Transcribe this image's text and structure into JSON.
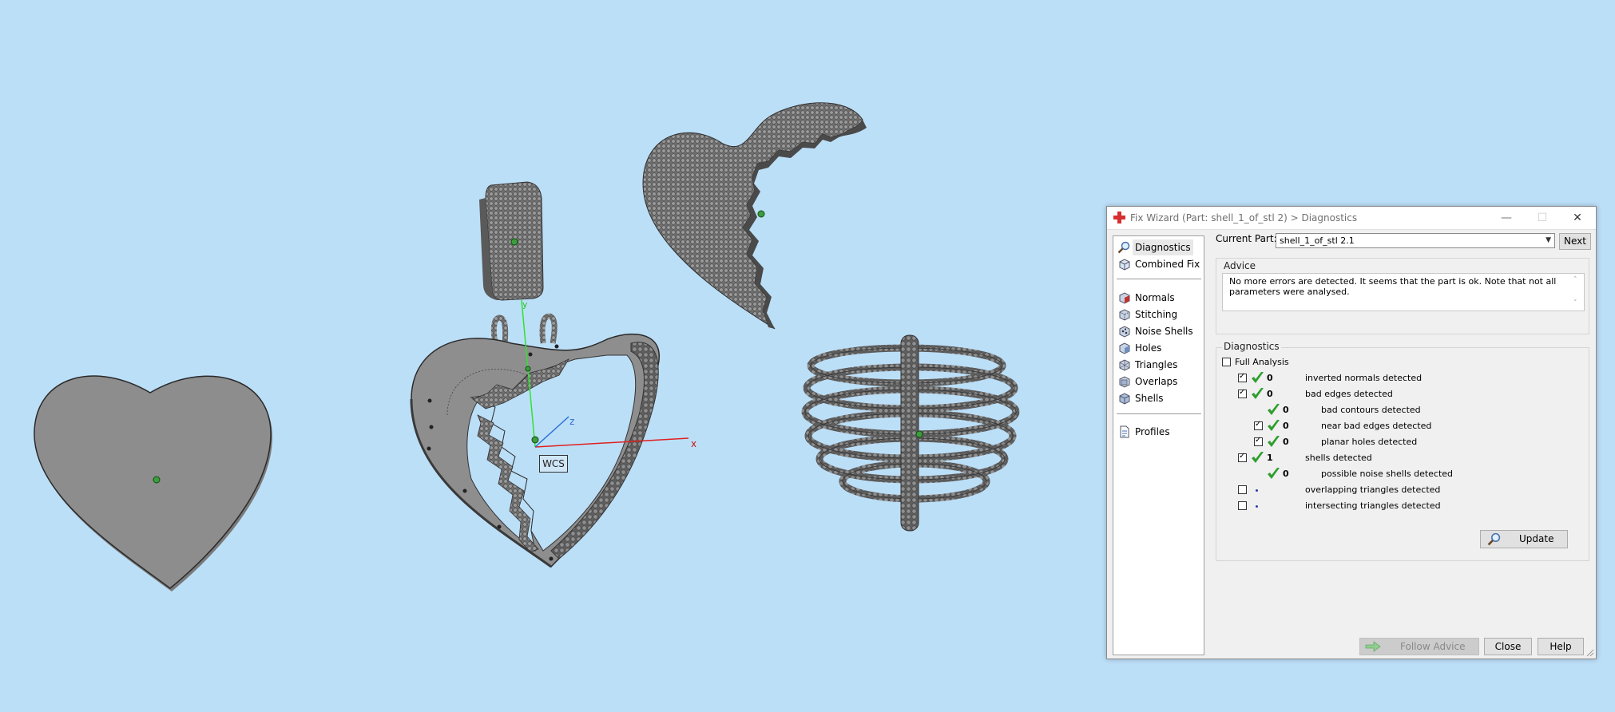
{
  "viewport": {
    "wcs_label": "WCS",
    "axis_x": "x",
    "axis_y": "y",
    "axis_z": "z"
  },
  "dialog": {
    "title": "Fix Wizard (Part: shell_1_of_stl 2) > Diagnostics",
    "window_controls": {
      "minimize": "—",
      "maximize": "☐",
      "close": "✕"
    },
    "nav": {
      "top_items": [
        {
          "label": "Diagnostics",
          "icon": "magnifier-icon",
          "selected": true
        },
        {
          "label": "Combined Fix",
          "icon": "cube-icon"
        }
      ],
      "fix_items": [
        {
          "label": "Normals",
          "icon": "normals-cube-icon"
        },
        {
          "label": "Stitching",
          "icon": "stitching-cube-icon"
        },
        {
          "label": "Noise Shells",
          "icon": "noise-shells-icon"
        },
        {
          "label": "Holes",
          "icon": "holes-cube-icon"
        },
        {
          "label": "Triangles",
          "icon": "triangles-cube-icon"
        },
        {
          "label": "Overlaps",
          "icon": "overlaps-cube-icon"
        },
        {
          "label": "Shells",
          "icon": "shells-cube-icon"
        }
      ],
      "bottom_items": [
        {
          "label": "Profiles",
          "icon": "profiles-icon"
        }
      ]
    },
    "current_part_label": "Current Part:",
    "current_part_value": "shell_1_of_stl 2.1",
    "next_button": "Next",
    "advice": {
      "title": "Advice",
      "text": "No more errors are detected. It seems that the part is ok. Note that not all parameters were analysed."
    },
    "diagnostics": {
      "title": "Diagnostics",
      "full_analysis_label": "Full Analysis",
      "full_analysis_checked": false,
      "rows": [
        {
          "label": "inverted normals detected",
          "value": "0",
          "checked": true,
          "ok": true,
          "has_checkbox": true,
          "indent": 0
        },
        {
          "label": "bad edges detected",
          "value": "0",
          "checked": true,
          "ok": true,
          "has_checkbox": true,
          "indent": 0
        },
        {
          "label": "bad contours detected",
          "value": "0",
          "checked": false,
          "ok": true,
          "has_checkbox": false,
          "indent": 1
        },
        {
          "label": "near bad edges detected",
          "value": "0",
          "checked": true,
          "ok": true,
          "has_checkbox": true,
          "indent": 1
        },
        {
          "label": "planar holes detected",
          "value": "0",
          "checked": true,
          "ok": true,
          "has_checkbox": true,
          "indent": 1
        },
        {
          "label": "shells detected",
          "value": "1",
          "checked": true,
          "ok": true,
          "has_checkbox": true,
          "indent": 0
        },
        {
          "label": "possible noise shells detected",
          "value": "0",
          "checked": false,
          "ok": true,
          "has_checkbox": false,
          "indent": 1
        },
        {
          "label": "overlapping triangles detected",
          "value": "",
          "checked": false,
          "ok": false,
          "has_checkbox": true,
          "indent": 0
        },
        {
          "label": "intersecting triangles detected",
          "value": "",
          "checked": false,
          "ok": false,
          "has_checkbox": true,
          "indent": 0
        }
      ],
      "update_button": "Update"
    },
    "footer": {
      "follow_advice": "Follow Advice",
      "close": "Close",
      "help": "Help"
    }
  },
  "colors": {
    "background": "#bcdff8",
    "model_gray": "#8c8c8c",
    "check_green": "#2f9e2f",
    "app_red": "#d62f2f"
  }
}
